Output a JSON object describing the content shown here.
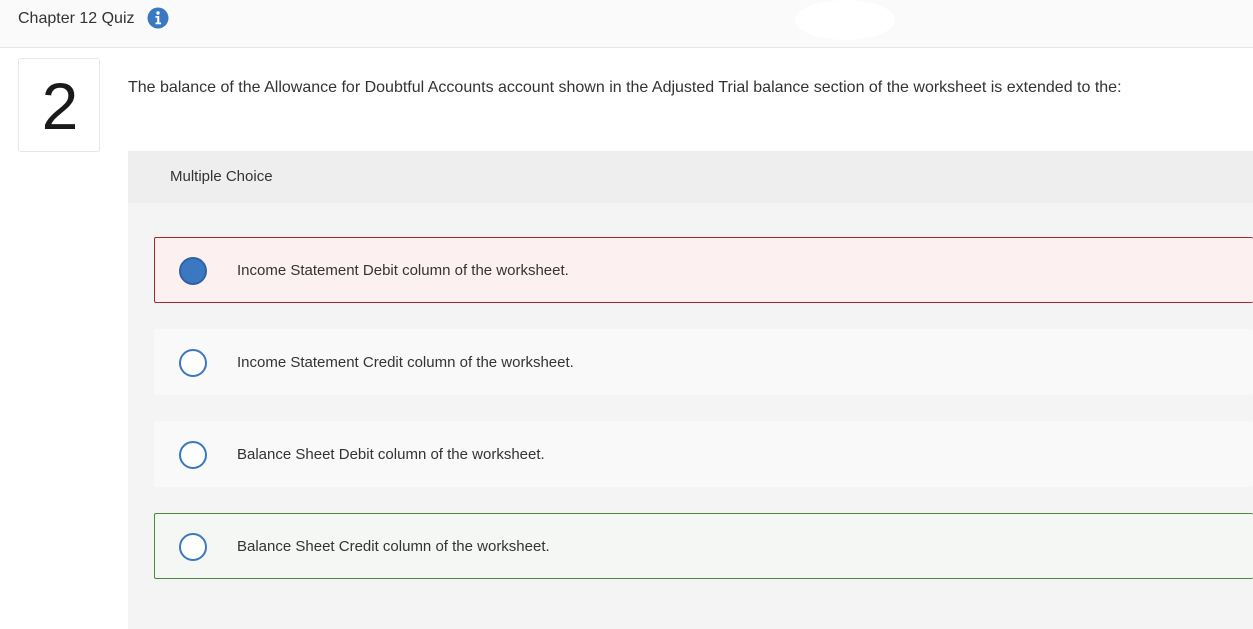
{
  "header": {
    "title": "Chapter 12 Quiz",
    "info_icon": "info-icon"
  },
  "question": {
    "number": "2",
    "prompt": "The balance of the Allowance for Doubtful Accounts account shown in the Adjusted Trial balance section of the worksheet is extended to the:"
  },
  "choices_panel": {
    "label": "Multiple Choice",
    "options": [
      {
        "text": "Income Statement Debit column of the worksheet.",
        "selected": true,
        "status": "incorrect"
      },
      {
        "text": "Income Statement Credit column of the worksheet.",
        "selected": false,
        "status": "none"
      },
      {
        "text": "Balance Sheet Debit column of the worksheet.",
        "selected": false,
        "status": "none"
      },
      {
        "text": "Balance Sheet Credit column of the worksheet.",
        "selected": false,
        "status": "correct"
      }
    ]
  },
  "colors": {
    "accent_blue": "#3a78c2",
    "incorrect_border": "#a8262e",
    "correct_border": "#4a8a3c"
  }
}
